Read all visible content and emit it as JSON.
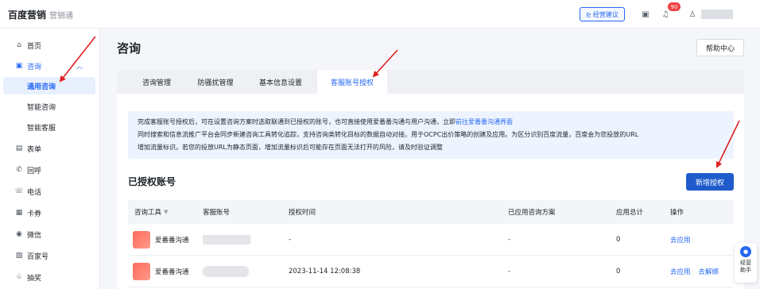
{
  "header": {
    "logo_mark": "百度营销",
    "logo_sub": "营销通",
    "advice_label": "经营建议",
    "notification_count": "90"
  },
  "sidebar": {
    "items": [
      {
        "icon": "home-icon",
        "glyph": "⌂",
        "label": "首页"
      },
      {
        "icon": "consult-icon",
        "glyph": "▣",
        "label": "咨询",
        "expanded": true
      },
      {
        "icon": "form-icon",
        "glyph": "▤",
        "label": "表单"
      },
      {
        "icon": "callback-icon",
        "glyph": "✆",
        "label": "回呼"
      },
      {
        "icon": "phone-icon",
        "glyph": "☏",
        "label": "电话"
      },
      {
        "icon": "coupon-icon",
        "glyph": "▦",
        "label": "卡券"
      },
      {
        "icon": "wechat-icon",
        "glyph": "◉",
        "label": "微信"
      },
      {
        "icon": "baijiahao-icon",
        "glyph": "▧",
        "label": "百家号"
      },
      {
        "icon": "lottery-icon",
        "glyph": "♧",
        "label": "抽奖"
      }
    ],
    "sub_items": [
      {
        "label": "通用咨询",
        "selected": true
      },
      {
        "label": "智能咨询",
        "selected": false
      },
      {
        "label": "智能客服",
        "selected": false
      }
    ]
  },
  "main": {
    "title": "咨询",
    "help_label": "帮助中心",
    "tabs": [
      {
        "label": "咨询管理"
      },
      {
        "label": "防骚扰管理"
      },
      {
        "label": "基本信息设置"
      },
      {
        "label": "客服账号授权",
        "active": true
      }
    ],
    "notice": {
      "line1_text": "完成客服账号授权后，可在设置咨询方案时选取联通到已授权的账号，也可直接使用爱番番沟通与用户沟通，立即",
      "line1_link": "前往爱番番沟通界面",
      "line2": "同时搜索和信息流推广平台会同步新建咨询工具转化追踪，支持咨询类转化目标的数据自动对接。用于OCPC出价策略的创建及应用。为区分识别百度流量，百度会为您投放的URL",
      "line3": "增加流量标识。若您的投放URL为静态页面，增加流量标识后可能存在页面无法打开的风险，请及时验证调整"
    },
    "section_title": "已授权账号",
    "add_button": "新增授权",
    "table": {
      "columns": [
        "咨询工具",
        "客服账号",
        "授权时间",
        "已应用咨询方案",
        "应用总计",
        "操作"
      ],
      "rows": [
        {
          "tool": "爱番番沟通",
          "time": "-",
          "plan": "-",
          "total": "0",
          "actions": [
            "去应用"
          ]
        },
        {
          "tool": "爱番番沟通",
          "time": "2023-11-14 12:08:38",
          "plan": "-",
          "total": "0",
          "actions": [
            "去应用",
            "去解绑"
          ]
        }
      ]
    }
  },
  "float_helper": {
    "label": "经营助手"
  },
  "colors": {
    "accent": "#2468f2",
    "primary_button": "#1f5bcc",
    "annotation_arrow": "#e02020"
  }
}
